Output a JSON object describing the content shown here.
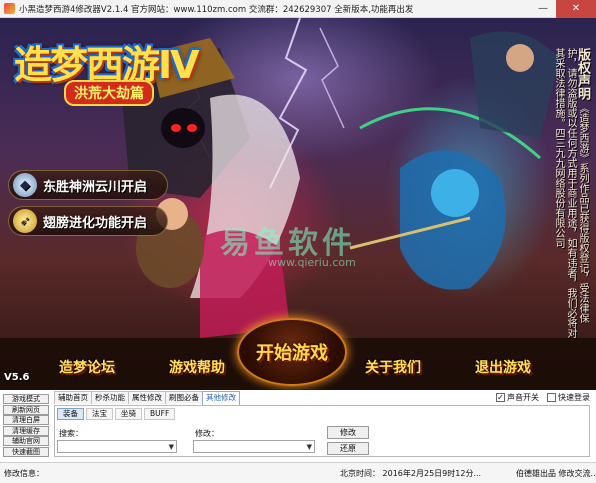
{
  "window": {
    "title": "小黑造梦西游4修改器V2.1.4   官方网站：www.110zm.com   交流群：242629307 全新版本,功能再出发",
    "buttons": {
      "minimize": "—",
      "close": "✕"
    }
  },
  "banner": {
    "logo_title": "造梦西游IV",
    "logo_subtitle": "洪荒大劫篇",
    "features": [
      "东胜神洲云川开启",
      "翅膀进化功能开启"
    ],
    "copyright_title": "版权声明",
    "copyright_text": "《造梦西游》系列作品已获得版权登记，受法律保护，请勿盗版或以任何方式用于商业用途，如有违者，我们必将对其采取法律措施。四三九九网络股份有限公司",
    "watermark": "易鱼软件",
    "watermark_url": "www.qieriu.com",
    "start_button": "开始游戏",
    "menu": [
      "造梦论坛",
      "游戏帮助",
      "关于我们",
      "退出游戏"
    ],
    "version": "V5.6"
  },
  "sidebar": [
    "游戏模式",
    "刷新网页",
    "清理白屏",
    "清理缓存",
    "辅助官网",
    "快速截图"
  ],
  "main_tabs": {
    "items": [
      "辅助首页",
      "秒杀功能",
      "属性修改",
      "刷图必备",
      "其他修改"
    ],
    "active_index": 4
  },
  "checkboxes": [
    {
      "label": "声音开关",
      "checked": true
    },
    {
      "label": "快速登录",
      "checked": false
    }
  ],
  "sub_tabs": {
    "items": [
      "装备",
      "法宝",
      "坐骑",
      "BUFF"
    ],
    "active_index": 0
  },
  "fields": {
    "search_label": "搜索：",
    "edit_label": "修改："
  },
  "actions": {
    "modify": "修改",
    "restore": "还原"
  },
  "status": {
    "label": "修改信息：",
    "time": "北京时间：  2016年2月25日9时12分...",
    "credit": "伯德雄出品  修改交流..."
  }
}
